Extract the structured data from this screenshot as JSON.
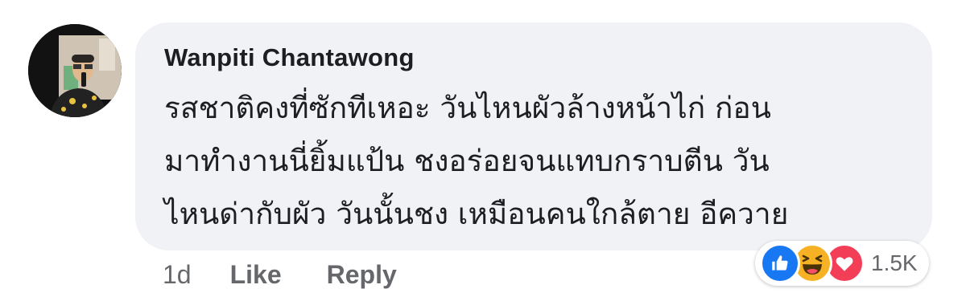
{
  "comment": {
    "author": "Wanpiti Chantawong",
    "text_lines": [
      "รสชาติคงที่ซักทีเหอะ วันไหนผัวล้างหน้าไก่ ก่อน",
      "มาทำงานนี่ยิ้มแป้น ชงอร่อยจนแทบกราบตีน วัน",
      "ไหนด่ากับผัว วันนั้นชง เหมือนคนใกล้ตาย อีควาย"
    ],
    "time": "1d",
    "like_label": "Like",
    "reply_label": "Reply"
  },
  "reactions": {
    "icons": [
      "like-icon",
      "haha-icon",
      "love-icon"
    ],
    "count": "1.5K",
    "colors": {
      "like": "#1877f2",
      "haha": "#f7b125",
      "love": "#f33e58"
    }
  },
  "colors": {
    "bubble": "#f0f2f5",
    "text": "#1c1e21",
    "meta": "#65676b"
  }
}
